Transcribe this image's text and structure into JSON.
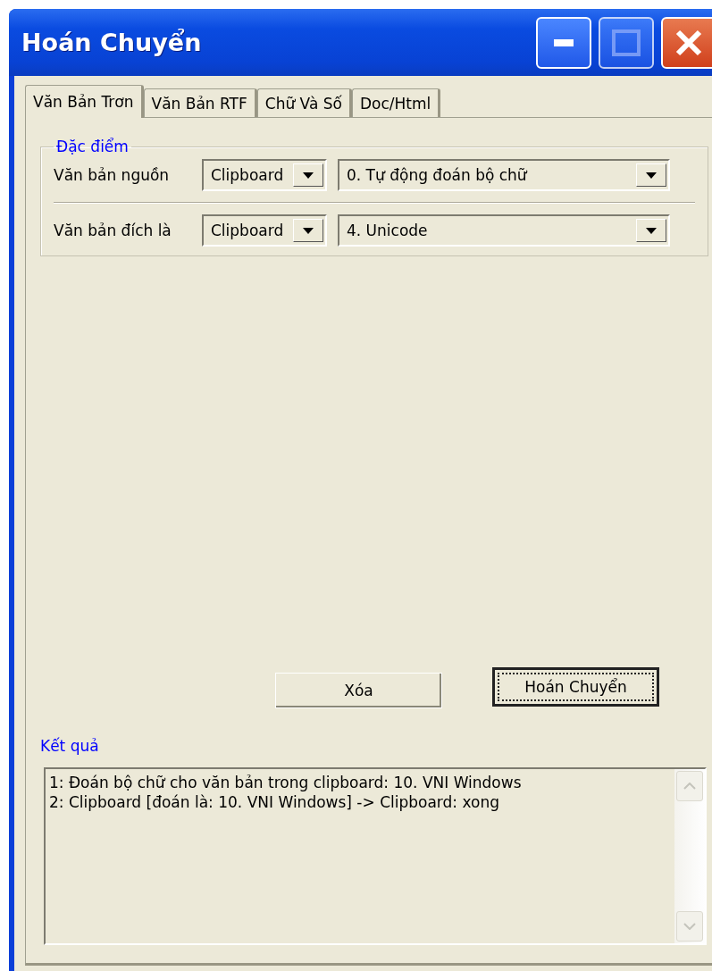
{
  "window": {
    "title": "Hoán Chuyển"
  },
  "tabs": [
    {
      "label": "Văn Bản Trơn",
      "selected": true
    },
    {
      "label": "Văn Bản RTF",
      "selected": false
    },
    {
      "label": "Chữ Và Số",
      "selected": false
    },
    {
      "label": "Doc/Html",
      "selected": false
    }
  ],
  "group": {
    "title": "Đặc điểm",
    "rows": [
      {
        "label": "Văn bản nguồn",
        "target": "Clipboard",
        "encoding": "0. Tự động đoán bộ chữ"
      },
      {
        "label": "Văn bản đích là",
        "target": "Clipboard",
        "encoding": "4. Unicode"
      }
    ]
  },
  "buttons": [
    {
      "label": "Xóa",
      "default": false
    },
    {
      "label": "Hoán Chuyển",
      "default": true
    }
  ],
  "result": {
    "title": "Kết quả",
    "lines": [
      "1: Đoán bộ chữ cho văn bản trong clipboard: 10. VNI Windows",
      "2: Clipboard [đoán là: 10. VNI Windows] -> Clipboard: xong"
    ]
  }
}
